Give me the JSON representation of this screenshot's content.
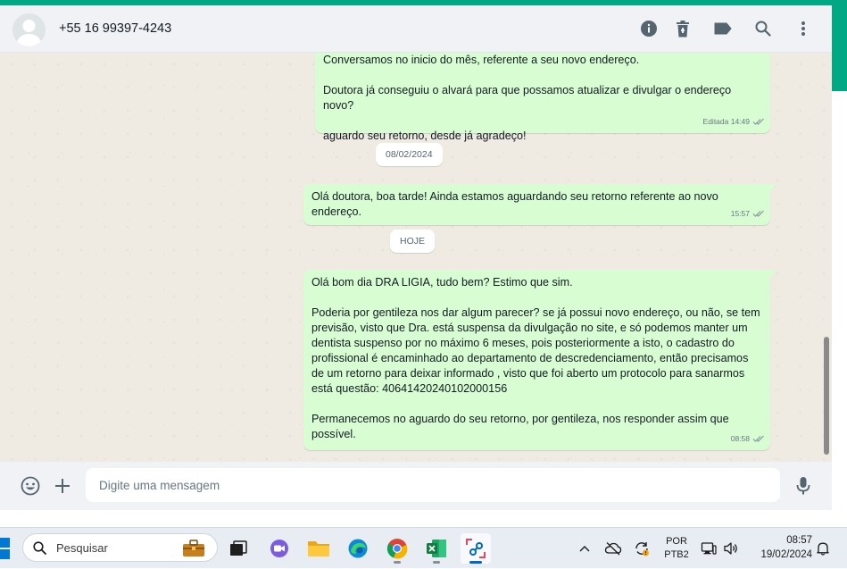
{
  "header": {
    "contact": "+55 16 99397-4243",
    "icons": [
      "info-icon",
      "trash-icon",
      "label-icon",
      "search-icon",
      "more-vertical-icon"
    ]
  },
  "messages": [
    {
      "paragraphs": [
        "Conversamos no inicio do mês, referente a seu novo endereço.",
        "Doutora já conseguiu o alvará para que possamos atualizar e divulgar o endereço novo?",
        "aguardo seu retorno, desde já agradeço!"
      ],
      "meta": "Editada 14:49"
    },
    {
      "paragraphs": [
        "Olá doutora, boa tarde! Ainda estamos aguardando seu retorno referente ao novo endereço."
      ],
      "meta": "15:57"
    },
    {
      "paragraphs": [
        "Olá bom dia DRA LIGIA, tudo bem? Estimo que sim.",
        "Poderia por gentileza nos dar algum parecer? se já possui novo endereço, ou não, se tem previsão, visto que Dra. está suspensa da divulgação no site, e só podemos manter um dentista suspenso por no máximo 6 meses, pois posteriormente a isto, o cadastro do profissional é encaminhado ao departamento de descredenciamento, então precisamos de um retorno para deixar informado , visto que foi aberto um protocolo para sanarmos está questão: 40641420240102000156",
        "Permanecemos no aguardo do seu retorno, por gentileza, nos responder assim que possível."
      ],
      "meta": "08:58"
    }
  ],
  "dates": [
    "08/02/2024",
    "HOJE"
  ],
  "composer": {
    "placeholder": "Digite uma mensagem",
    "icons": [
      "emoji-icon",
      "plus-icon",
      "microphone-icon"
    ]
  },
  "taskbar": {
    "search_placeholder": "Pesquisar",
    "language_line1": "POR",
    "language_line2": "PTB2",
    "time": "08:57",
    "date": "19/02/2024"
  },
  "colors": {
    "accent": "#00a884",
    "outgoing_bubble": "#d9fdd3",
    "chat_background": "#efeae2",
    "tick": "#8696a0"
  }
}
